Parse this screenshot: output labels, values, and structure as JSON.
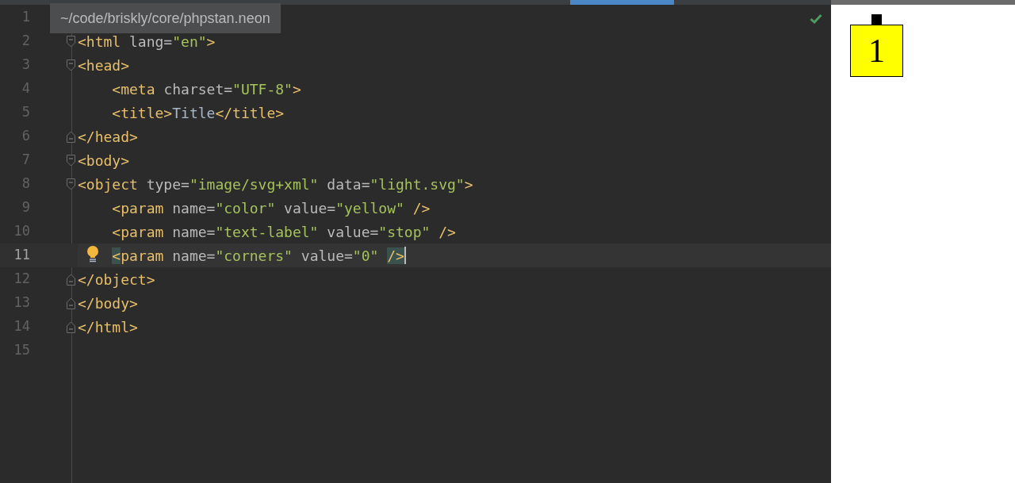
{
  "tooltip": "~/code/briskly/core/phpstan.neon",
  "lines": [
    {
      "number": "1",
      "kind": "plain",
      "selected": false
    },
    {
      "number": "2",
      "kind": "open",
      "selected": false,
      "hint": false,
      "tokens": [
        {
          "kind": "tag",
          "text": "<html"
        },
        {
          "kind": "attr",
          "text": " lang="
        },
        {
          "kind": "value",
          "text": "\"en\""
        },
        {
          "kind": "tag",
          "text": ">"
        }
      ]
    },
    {
      "number": "3",
      "kind": "open",
      "selected": false,
      "hint": false,
      "tokens": [
        {
          "kind": "tag",
          "text": "<head>"
        }
      ]
    },
    {
      "number": "4",
      "kind": "plain",
      "selected": false,
      "hint": false,
      "tokens": [
        {
          "kind": "tag",
          "text": "    <meta"
        },
        {
          "kind": "attr",
          "text": " charset="
        },
        {
          "kind": "value",
          "text": "\"UTF-8\""
        },
        {
          "kind": "tag",
          "text": ">"
        }
      ]
    },
    {
      "number": "5",
      "kind": "plain",
      "selected": false,
      "hint": false,
      "tokens": [
        {
          "kind": "tag",
          "text": "    <title>"
        },
        {
          "kind": "text",
          "text": "Title"
        },
        {
          "kind": "tag",
          "text": "</title>"
        }
      ]
    },
    {
      "number": "6",
      "kind": "close",
      "selected": false,
      "hint": false,
      "tokens": [
        {
          "kind": "tag",
          "text": "</head>"
        }
      ]
    },
    {
      "number": "7",
      "kind": "open",
      "selected": false,
      "hint": false,
      "tokens": [
        {
          "kind": "tag",
          "text": "<body>"
        }
      ]
    },
    {
      "number": "8",
      "kind": "open",
      "selected": false,
      "hint": false,
      "tokens": [
        {
          "kind": "tag",
          "text": "<object"
        },
        {
          "kind": "attr",
          "text": " type="
        },
        {
          "kind": "value",
          "text": "\"image/svg+xml\""
        },
        {
          "kind": "attr",
          "text": " data="
        },
        {
          "kind": "value",
          "text": "\"light.svg\""
        },
        {
          "kind": "tag",
          "text": ">"
        }
      ]
    },
    {
      "number": "9",
      "kind": "plain",
      "selected": false,
      "hint": false,
      "tokens": [
        {
          "kind": "tag",
          "text": "    <param"
        },
        {
          "kind": "attr",
          "text": " name="
        },
        {
          "kind": "value",
          "text": "\"color\""
        },
        {
          "kind": "attr",
          "text": " value="
        },
        {
          "kind": "value",
          "text": "\"yellow\""
        },
        {
          "kind": "tag",
          "text": " />"
        }
      ]
    },
    {
      "number": "10",
      "kind": "plain",
      "selected": false,
      "hint": false,
      "tokens": [
        {
          "kind": "tag",
          "text": "    <param"
        },
        {
          "kind": "attr",
          "text": " name="
        },
        {
          "kind": "value",
          "text": "\"text-label\""
        },
        {
          "kind": "attr",
          "text": " value="
        },
        {
          "kind": "value",
          "text": "\"stop\""
        },
        {
          "kind": "tag",
          "text": " />"
        }
      ]
    },
    {
      "number": "11",
      "kind": "plain",
      "selected": true,
      "hint": true,
      "tokens": [
        {
          "kind": "match",
          "text": "    <"
        },
        {
          "kind": "tag",
          "text": "param"
        },
        {
          "kind": "attr",
          "text": " name="
        },
        {
          "kind": "value",
          "text": "\"corners\""
        },
        {
          "kind": "attr",
          "text": " value="
        },
        {
          "kind": "value",
          "text": "\"0\" "
        },
        {
          "kind": "match",
          "text": "/>"
        }
      ]
    },
    {
      "number": "12",
      "kind": "close",
      "selected": false,
      "hint": false,
      "tokens": [
        {
          "kind": "tag",
          "text": "</object>"
        }
      ]
    },
    {
      "number": "13",
      "kind": "close",
      "selected": false,
      "hint": false,
      "tokens": [
        {
          "kind": "tag",
          "text": "</body>"
        }
      ]
    },
    {
      "number": "14",
      "kind": "close",
      "selected": false,
      "hint": false,
      "tokens": [
        {
          "kind": "tag",
          "text": "</html>"
        }
      ]
    },
    {
      "number": "15",
      "kind": "plain",
      "selected": false,
      "hint": false
    }
  ],
  "preview": {
    "label": "1",
    "color": "#ffff00"
  }
}
